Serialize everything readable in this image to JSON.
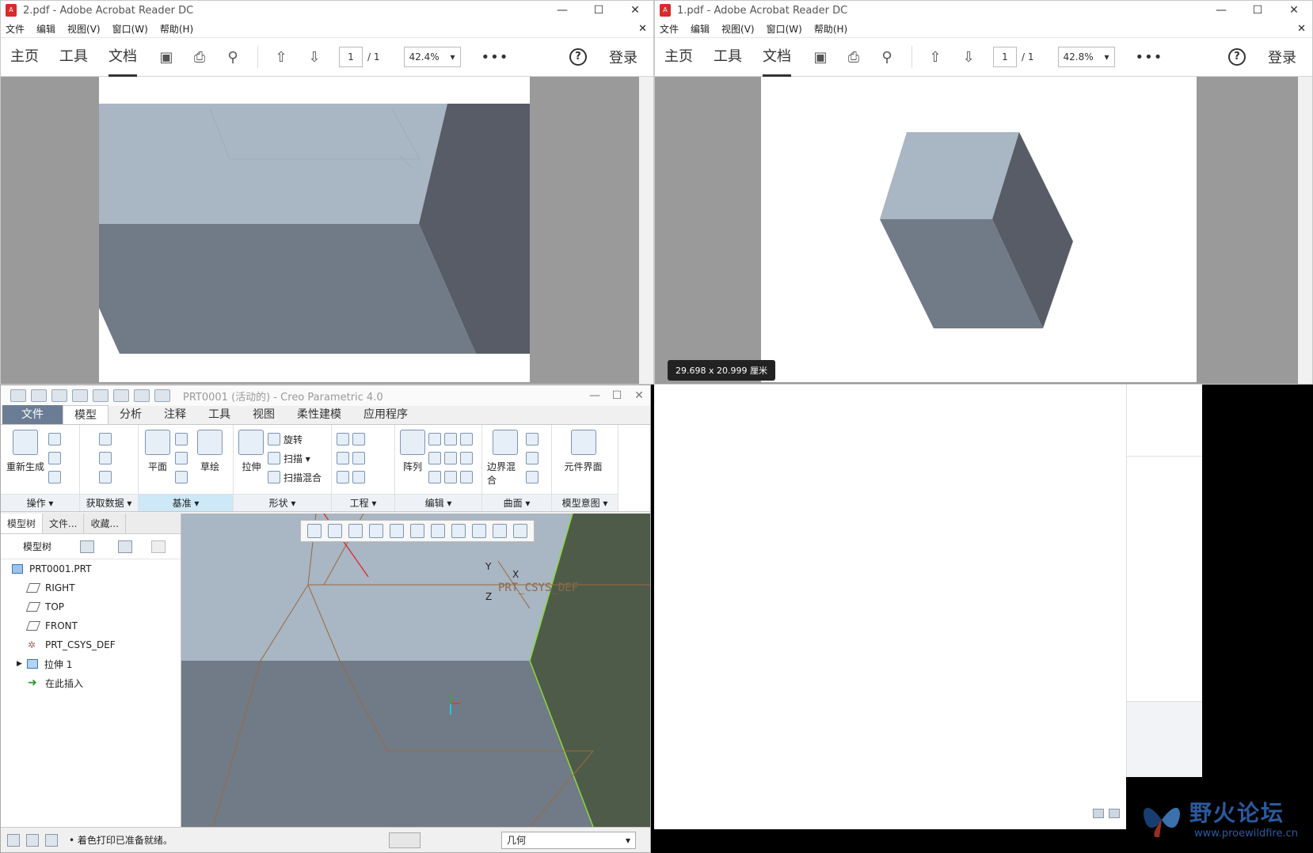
{
  "acrobat_left": {
    "title": "2.pdf - Adobe Acrobat Reader DC",
    "menu": [
      "文件",
      "编辑",
      "视图(V)",
      "窗口(W)",
      "帮助(H)"
    ],
    "tabs": [
      "主页",
      "工具",
      "文档"
    ],
    "page_current": "1",
    "page_total": "/ 1",
    "zoom": "42.4%",
    "login": "登录"
  },
  "acrobat_right": {
    "title": "1.pdf - Adobe Acrobat Reader DC",
    "menu": [
      "文件",
      "编辑",
      "视图(V)",
      "窗口(W)",
      "帮助(H)"
    ],
    "tabs": [
      "主页",
      "工具",
      "文档"
    ],
    "page_current": "1",
    "page_total": "/ 1",
    "zoom": "42.8%",
    "login": "登录",
    "page_size_tooltip": "29.698 x 20.999 厘米"
  },
  "creo": {
    "title": "PRT0001 (活动的) - Creo Parametric 4.0",
    "ribbon_tabs": [
      "文件",
      "模型",
      "分析",
      "注释",
      "工具",
      "视图",
      "柔性建模",
      "应用程序"
    ],
    "groups": {
      "operations": {
        "label": "操作 ▾",
        "regen": "重新生成"
      },
      "getdata": {
        "label": "获取数据 ▾"
      },
      "datum": {
        "label": "基准 ▾",
        "plane": "平面",
        "sketch": "草绘"
      },
      "shapes": {
        "label": "形状 ▾",
        "extrude": "拉伸",
        "revolve": "旋转",
        "sweep": "扫描 ▾",
        "swept_blend": "扫描混合"
      },
      "engineering": {
        "label": "工程 ▾"
      },
      "editing": {
        "label": "编辑 ▾",
        "pattern": "阵列"
      },
      "surfaces": {
        "label": "曲面 ▾",
        "boundary_blend": "边界混合"
      },
      "model_intent": {
        "label": "模型意图 ▾",
        "component_interface": "元件界面"
      }
    },
    "tree_tabs": [
      "模型树",
      "文件...",
      "收藏..."
    ],
    "tree_header": "模型树",
    "tree_items": [
      "PRT0001.PRT",
      "RIGHT",
      "TOP",
      "FRONT",
      "PRT_CSYS_DEF",
      "拉伸 1",
      "在此插入"
    ],
    "csys_label": "PRT_CSYS_DEF",
    "axis_labels": {
      "x": "X",
      "y": "Y",
      "z": "Z"
    },
    "status_message": "• 着色打印已准备就绪。",
    "selection_filter": "几何"
  },
  "watermark": {
    "title": "野火论坛",
    "url": "www.proewildfire.cn"
  }
}
